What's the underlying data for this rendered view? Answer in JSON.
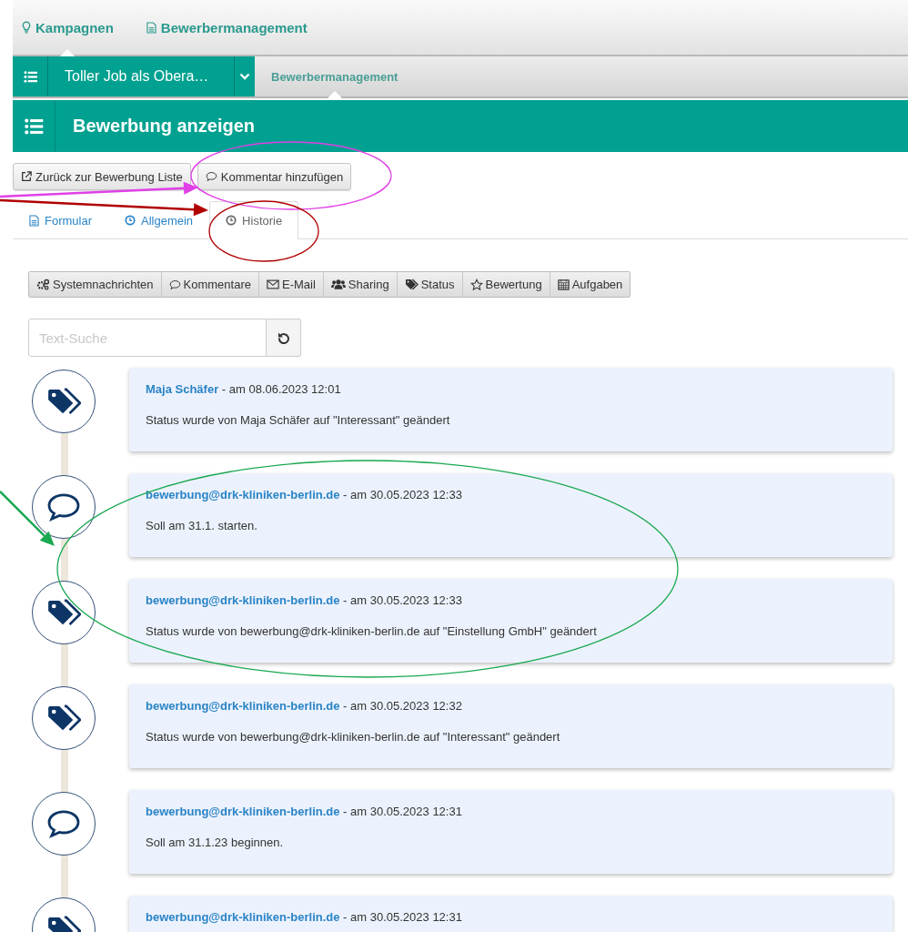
{
  "top_nav": {
    "items": [
      {
        "label": "Kampagnen",
        "selected": true
      },
      {
        "label": "Bewerbermanagement",
        "selected": false
      }
    ]
  },
  "sub_nav": {
    "campaign": "Toller Job als Obera…",
    "items": [
      {
        "label": "Bewerbermanagement",
        "selected": true
      }
    ]
  },
  "header": {
    "title": "Bewerbung anzeigen"
  },
  "actions": [
    "Zurück zur Bewerbung Liste",
    "Kommentar hinzufügen"
  ],
  "tabs": [
    {
      "label": "Formular",
      "selected": false
    },
    {
      "label": "Allgemein",
      "selected": false
    },
    {
      "label": "Historie",
      "selected": true
    }
  ],
  "filters": [
    "Systemnachrichten",
    "Kommentare",
    "E-Mail",
    "Sharing",
    "Status",
    "Bewertung",
    "Aufgaben"
  ],
  "search": {
    "placeholder": "Text-Suche"
  },
  "timeline": [
    {
      "kind": "status",
      "author": "Maja Schäfer",
      "date": " - am 08.06.2023 12:01",
      "message": "Status wurde von Maja Schäfer auf \"Interessant\" geändert"
    },
    {
      "kind": "comment",
      "author": "bewerbung@drk-kliniken-berlin.de",
      "date": " - am 30.05.2023 12:33",
      "message": "Soll am 31.1. starten."
    },
    {
      "kind": "status",
      "author": "bewerbung@drk-kliniken-berlin.de",
      "date": " - am 30.05.2023 12:33",
      "message": "Status wurde von bewerbung@drk-kliniken-berlin.de auf \"Einstellung GmbH\" geändert"
    },
    {
      "kind": "status",
      "author": "bewerbung@drk-kliniken-berlin.de",
      "date": " - am 30.05.2023 12:32",
      "message": "Status wurde von bewerbung@drk-kliniken-berlin.de auf \"Interessant\" geändert"
    },
    {
      "kind": "comment",
      "author": "bewerbung@drk-kliniken-berlin.de",
      "date": " - am 30.05.2023 12:31",
      "message": "Soll am 31.1.23 beginnen."
    },
    {
      "kind": "status",
      "author": "bewerbung@drk-kliniken-berlin.de",
      "date": " - am 30.05.2023 12:31"
    }
  ],
  "annotations": [
    {
      "kind": "ellipse",
      "color": "#e040e6"
    },
    {
      "kind": "arrow",
      "color": "#e040e6"
    },
    {
      "kind": "ellipse",
      "color": "#b00000"
    },
    {
      "kind": "arrow",
      "color": "#b00000"
    },
    {
      "kind": "ellipse",
      "color": "#1aa850"
    },
    {
      "kind": "arrow",
      "color": "#1aa850"
    }
  ]
}
